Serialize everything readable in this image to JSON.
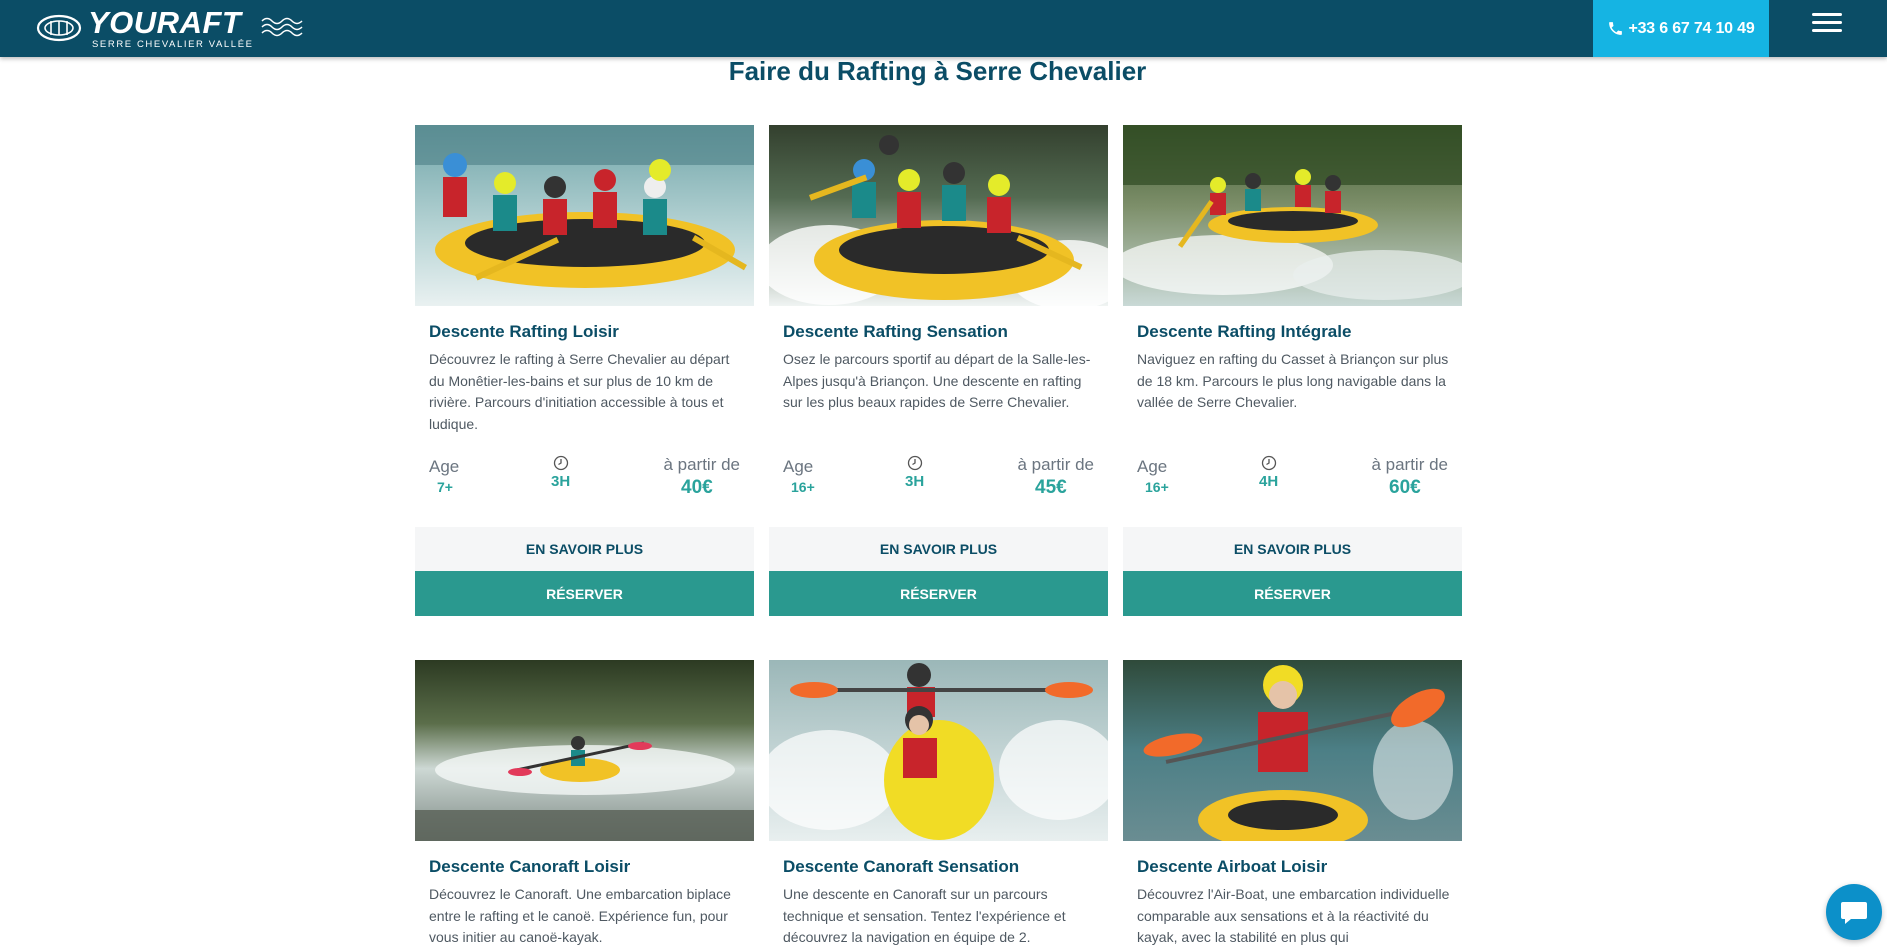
{
  "header": {
    "logo_name": "YOURAFT",
    "logo_sub": "SERRE CHEVALIER VALLÉE",
    "phone": "+33 6 67 74 10 49",
    "menu_icon": "hamburger-menu-icon"
  },
  "page": {
    "title": "Faire du Rafting à Serre Chevalier"
  },
  "cards": [
    {
      "title": "Descente Rafting Loisir",
      "description": "Découvrez le rafting à Serre Chevalier au départ du Monêtier-les-bains et sur plus de 10 km de rivière. Parcours d'initiation accessible à tous et ludique.",
      "age_label": "Age",
      "age": "7+",
      "duration": "3H",
      "from_label": "à partir de",
      "price": "40€",
      "more_label": "EN SAVOIR PLUS",
      "book_label": "RÉSERVER",
      "photo": "rafting-loisir-photo"
    },
    {
      "title": "Descente Rafting Sensation",
      "description": "Osez le parcours sportif au départ de la Salle-les-Alpes jusqu'à Briançon. Une descente en rafting sur les plus beaux rapides de Serre Chevalier.",
      "age_label": "Age",
      "age": "16+",
      "duration": "3H",
      "from_label": "à partir de",
      "price": "45€",
      "more_label": "EN SAVOIR PLUS",
      "book_label": "RÉSERVER",
      "photo": "rafting-sensation-photo"
    },
    {
      "title": "Descente Rafting Intégrale",
      "description": "Naviguez en rafting du Casset à Briançon sur plus de 18 km. Parcours le plus long navigable dans la vallée de Serre Chevalier.",
      "age_label": "Age",
      "age": "16+",
      "duration": "4H",
      "from_label": "à partir de",
      "price": "60€",
      "more_label": "EN SAVOIR PLUS",
      "book_label": "RÉSERVER",
      "photo": "rafting-integrale-photo"
    },
    {
      "title": "Descente Canoraft Loisir",
      "description": "Découvrez le Canoraft. Une embarcation biplace entre le rafting et le canoë. Expérience fun, pour vous initier au canoë-kayak.",
      "photo": "canoraft-loisir-photo"
    },
    {
      "title": "Descente Canoraft Sensation",
      "description": "Une descente en Canoraft sur un parcours technique et sensation. Tentez l'expérience et découvrez la navigation en équipe de 2.",
      "photo": "canoraft-sensation-photo"
    },
    {
      "title": "Descente Airboat Loisir",
      "description": "Découvrez l'Air-Boat, une embarcation individuelle comparable aux sensations et à la réactivité du kayak, avec la stabilité en plus qui",
      "photo": "airboat-loisir-photo"
    }
  ],
  "chat": {
    "icon": "chat-bubble-icon"
  }
}
